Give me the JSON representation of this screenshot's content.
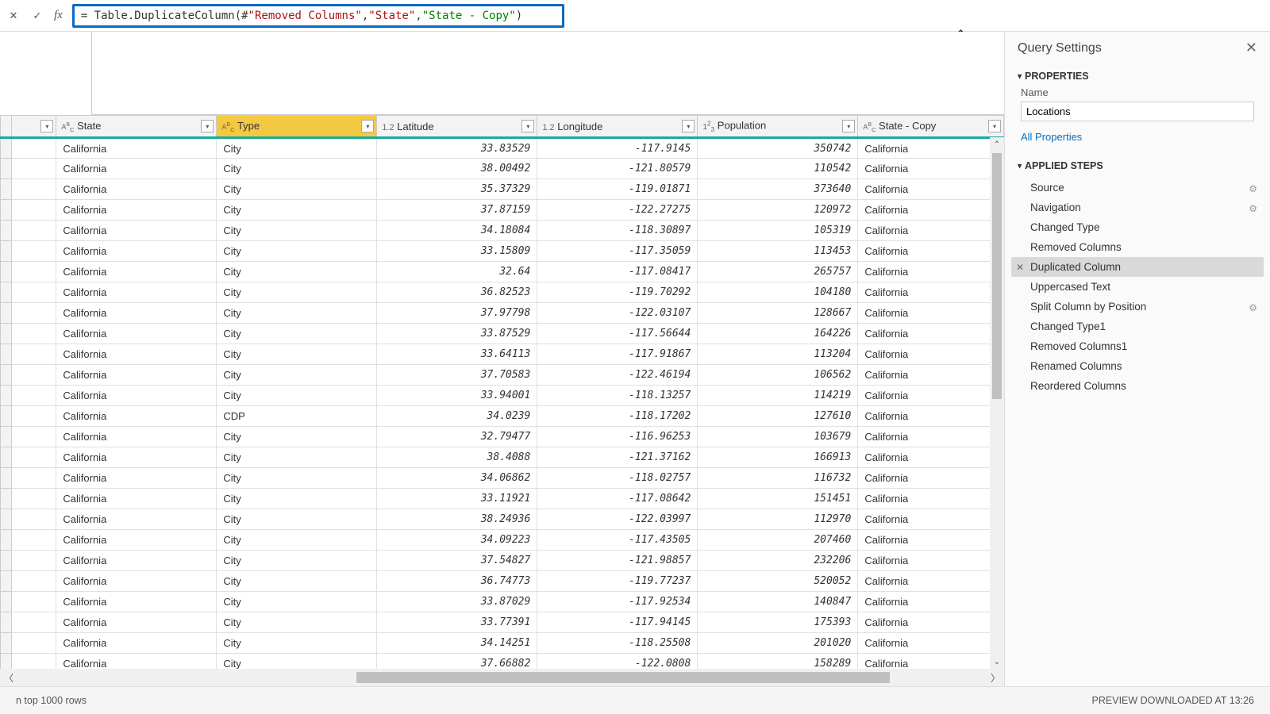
{
  "formula": {
    "prefix": "= Table.DuplicateColumn(#",
    "arg1": "\"Removed Columns\"",
    "comma1": ", ",
    "arg2": "\"State\"",
    "comma2": ", ",
    "arg3": "\"State - Copy\"",
    "suffix": ")"
  },
  "columns": {
    "c0": "",
    "c1": "State",
    "c2": "Type",
    "c3": "Latitude",
    "c4": "Longitude",
    "c5": "Population",
    "c6": "State - Copy"
  },
  "rows": [
    {
      "state": "California",
      "type": "City",
      "lat": "33.83529",
      "lon": "-117.9145",
      "pop": "350742",
      "copy": "California"
    },
    {
      "state": "California",
      "type": "City",
      "lat": "38.00492",
      "lon": "-121.80579",
      "pop": "110542",
      "copy": "California"
    },
    {
      "state": "California",
      "type": "City",
      "lat": "35.37329",
      "lon": "-119.01871",
      "pop": "373640",
      "copy": "California"
    },
    {
      "state": "California",
      "type": "City",
      "lat": "37.87159",
      "lon": "-122.27275",
      "pop": "120972",
      "copy": "California"
    },
    {
      "state": "California",
      "type": "City",
      "lat": "34.18084",
      "lon": "-118.30897",
      "pop": "105319",
      "copy": "California"
    },
    {
      "state": "California",
      "type": "City",
      "lat": "33.15809",
      "lon": "-117.35059",
      "pop": "113453",
      "copy": "California"
    },
    {
      "state": "California",
      "type": "City",
      "lat": "32.64",
      "lon": "-117.08417",
      "pop": "265757",
      "copy": "California"
    },
    {
      "state": "California",
      "type": "City",
      "lat": "36.82523",
      "lon": "-119.70292",
      "pop": "104180",
      "copy": "California"
    },
    {
      "state": "California",
      "type": "City",
      "lat": "37.97798",
      "lon": "-122.03107",
      "pop": "128667",
      "copy": "California"
    },
    {
      "state": "California",
      "type": "City",
      "lat": "33.87529",
      "lon": "-117.56644",
      "pop": "164226",
      "copy": "California"
    },
    {
      "state": "California",
      "type": "City",
      "lat": "33.64113",
      "lon": "-117.91867",
      "pop": "113204",
      "copy": "California"
    },
    {
      "state": "California",
      "type": "City",
      "lat": "37.70583",
      "lon": "-122.46194",
      "pop": "106562",
      "copy": "California"
    },
    {
      "state": "California",
      "type": "City",
      "lat": "33.94001",
      "lon": "-118.13257",
      "pop": "114219",
      "copy": "California"
    },
    {
      "state": "California",
      "type": "CDP",
      "lat": "34.0239",
      "lon": "-118.17202",
      "pop": "127610",
      "copy": "California"
    },
    {
      "state": "California",
      "type": "City",
      "lat": "32.79477",
      "lon": "-116.96253",
      "pop": "103679",
      "copy": "California"
    },
    {
      "state": "California",
      "type": "City",
      "lat": "38.4088",
      "lon": "-121.37162",
      "pop": "166913",
      "copy": "California"
    },
    {
      "state": "California",
      "type": "City",
      "lat": "34.06862",
      "lon": "-118.02757",
      "pop": "116732",
      "copy": "California"
    },
    {
      "state": "California",
      "type": "City",
      "lat": "33.11921",
      "lon": "-117.08642",
      "pop": "151451",
      "copy": "California"
    },
    {
      "state": "California",
      "type": "City",
      "lat": "38.24936",
      "lon": "-122.03997",
      "pop": "112970",
      "copy": "California"
    },
    {
      "state": "California",
      "type": "City",
      "lat": "34.09223",
      "lon": "-117.43505",
      "pop": "207460",
      "copy": "California"
    },
    {
      "state": "California",
      "type": "City",
      "lat": "37.54827",
      "lon": "-121.98857",
      "pop": "232206",
      "copy": "California"
    },
    {
      "state": "California",
      "type": "City",
      "lat": "36.74773",
      "lon": "-119.77237",
      "pop": "520052",
      "copy": "California"
    },
    {
      "state": "California",
      "type": "City",
      "lat": "33.87029",
      "lon": "-117.92534",
      "pop": "140847",
      "copy": "California"
    },
    {
      "state": "California",
      "type": "City",
      "lat": "33.77391",
      "lon": "-117.94145",
      "pop": "175393",
      "copy": "California"
    },
    {
      "state": "California",
      "type": "City",
      "lat": "34.14251",
      "lon": "-118.25508",
      "pop": "201020",
      "copy": "California"
    },
    {
      "state": "California",
      "type": "City",
      "lat": "37.66882",
      "lon": "-122.0808",
      "pop": "158289",
      "copy": "California"
    }
  ],
  "sidebar": {
    "title": "Query Settings",
    "properties_label": "PROPERTIES",
    "name_label": "Name",
    "name_value": "Locations",
    "all_props": "All Properties",
    "steps_label": "APPLIED STEPS",
    "steps": [
      {
        "label": "Source",
        "gear": true
      },
      {
        "label": "Navigation",
        "gear": true
      },
      {
        "label": "Changed Type",
        "gear": false
      },
      {
        "label": "Removed Columns",
        "gear": false
      },
      {
        "label": "Duplicated Column",
        "gear": false,
        "selected": true
      },
      {
        "label": "Uppercased Text",
        "gear": false
      },
      {
        "label": "Split Column by Position",
        "gear": true
      },
      {
        "label": "Changed Type1",
        "gear": false
      },
      {
        "label": "Removed Columns1",
        "gear": false
      },
      {
        "label": "Renamed Columns",
        "gear": false
      },
      {
        "label": "Reordered Columns",
        "gear": false
      }
    ]
  },
  "status": {
    "left": "n top 1000 rows",
    "right": "PREVIEW DOWNLOADED AT 13:26"
  }
}
